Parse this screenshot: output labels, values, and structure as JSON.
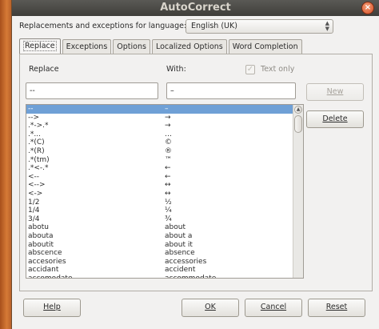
{
  "window": {
    "title": "AutoCorrect",
    "close_glyph": "×"
  },
  "language": {
    "label": "Replacements and exceptions for language:",
    "value": "English (UK)"
  },
  "tabs": [
    {
      "label": "Replace"
    },
    {
      "label": "Exceptions"
    },
    {
      "label": "Options"
    },
    {
      "label": "Localized Options"
    },
    {
      "label": "Word Completion"
    }
  ],
  "replace": {
    "replace_label": "Replace",
    "with_label": "With:",
    "text_only_label": "Text only",
    "replace_value": "--",
    "with_value": "–",
    "new_label": "New",
    "delete_label": "Delete"
  },
  "entries": [
    {
      "from": "--",
      "to": "–"
    },
    {
      "from": "-->",
      "to": "→"
    },
    {
      "from": ".*->.*",
      "to": "→"
    },
    {
      "from": ".*...",
      "to": "…"
    },
    {
      "from": ".*(C)",
      "to": "©"
    },
    {
      "from": ".*(R)",
      "to": "®"
    },
    {
      "from": ".*(tm)",
      "to": "™"
    },
    {
      "from": ".*<-.*",
      "to": "←"
    },
    {
      "from": "<--",
      "to": "←"
    },
    {
      "from": "<-->",
      "to": "↔"
    },
    {
      "from": "<->",
      "to": "↔"
    },
    {
      "from": "1/2",
      "to": "½"
    },
    {
      "from": "1/4",
      "to": "¼"
    },
    {
      "from": "3/4",
      "to": "¾"
    },
    {
      "from": "abotu",
      "to": "about"
    },
    {
      "from": "abouta",
      "to": "about a"
    },
    {
      "from": "aboutit",
      "to": "about it"
    },
    {
      "from": "abscence",
      "to": "absence"
    },
    {
      "from": "accesories",
      "to": "accessories"
    },
    {
      "from": "accidant",
      "to": "accident"
    },
    {
      "from": "accomodate",
      "to": "accommodate"
    }
  ],
  "footer": {
    "help_label": "Help",
    "ok_label": "OK",
    "cancel_label": "Cancel",
    "reset_label": "Reset"
  },
  "colors": {
    "selection": "#6fa0d6",
    "titlebar": "#3f3e3a"
  }
}
